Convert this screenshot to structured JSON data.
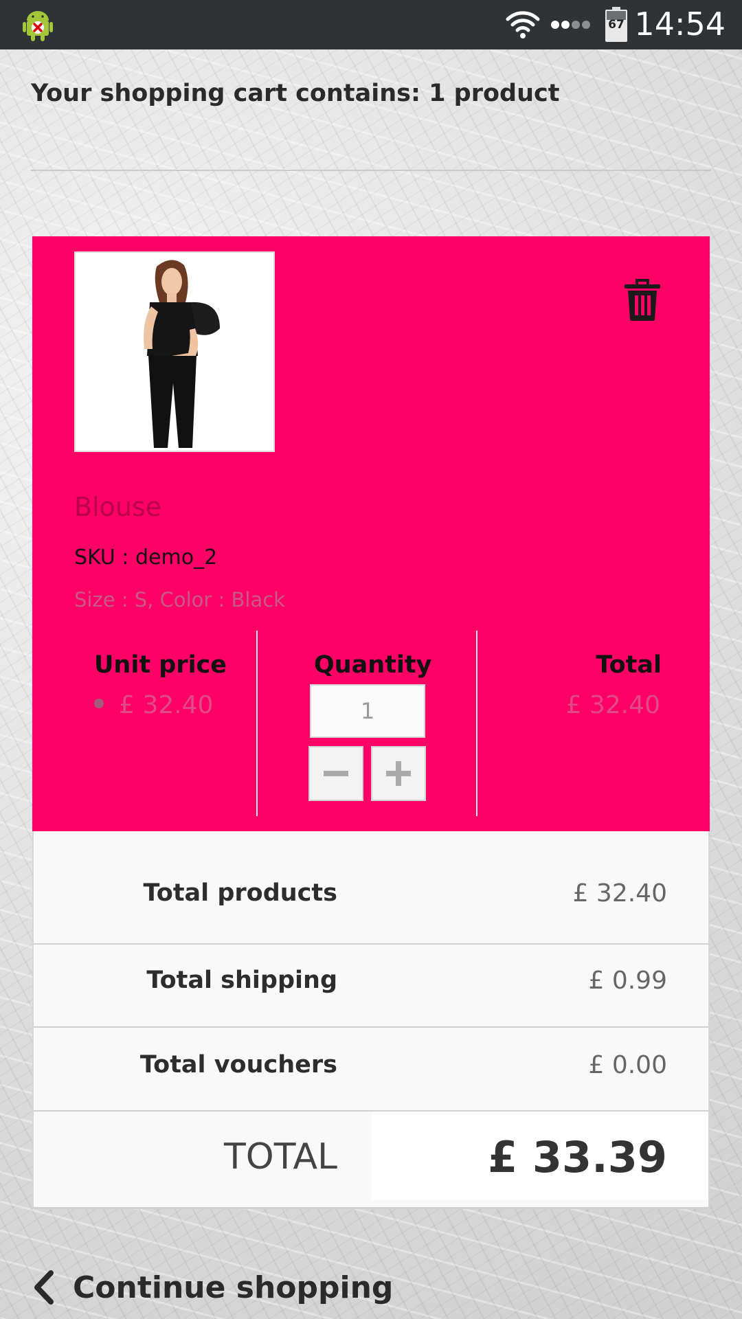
{
  "status_bar": {
    "battery_level": "67",
    "time": "14:54",
    "icons": [
      "android-debug-icon",
      "wifi-icon",
      "signal-icon",
      "battery-icon"
    ]
  },
  "cart": {
    "summary": "Your shopping cart contains: 1 product"
  },
  "product": {
    "name": "Blouse",
    "sku": "SKU : demo_2",
    "attributes": "Size : S, Color : Black",
    "unit_price_label": "Unit price",
    "quantity_label": "Quantity",
    "total_label": "Total",
    "unit_price": "£ 32.40",
    "quantity": "1",
    "total": "£ 32.40",
    "accent_color": "#ff0066"
  },
  "totals": {
    "rows": [
      {
        "label": "Total products",
        "value": "£ 32.40"
      },
      {
        "label": "Total shipping",
        "value": "£ 0.99"
      },
      {
        "label": "Total vouchers",
        "value": "£ 0.00"
      }
    ],
    "grand_label": "TOTAL",
    "grand_value": "£ 33.39"
  },
  "continue_shopping": "Continue shopping"
}
